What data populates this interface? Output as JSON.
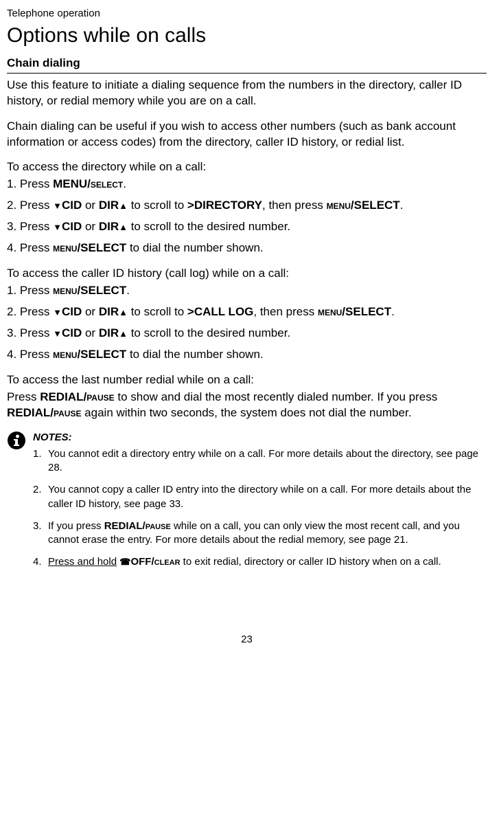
{
  "breadcrumb": "Telephone operation",
  "title": "Options while on calls",
  "section_heading": "Chain dialing",
  "intro1": "Use this feature to initiate a dialing sequence from the numbers in the directory, caller ID history, or redial memory while you are on a call.",
  "intro2": "Chain dialing can be useful if you wish to access other numbers (such as bank account information or access codes) from the directory, caller ID history, or redial list.",
  "dir_head": "To access the directory while on a call:",
  "dir_steps": {
    "s1a": "1. Press ",
    "s1b": "MENU/",
    "s1c": "SELECT",
    "s1d": ".",
    "s2a": "2. Press ",
    "s2b": "CID",
    "s2c": " or ",
    "s2d": "DIR",
    "s2e": " to scroll to ",
    "s2f": ">DIRECTORY",
    "s2g": ", then press ",
    "s2h": "MENU",
    "s2i": "/SELECT",
    "s2j": ".",
    "s3a": "3. Press ",
    "s3b": "CID",
    "s3c": " or ",
    "s3d": "DIR",
    "s3e": " to scroll to the desired number.",
    "s4a": "4. Press ",
    "s4b": "MENU",
    "s4c": "/SELECT",
    "s4d": " to dial the number shown."
  },
  "log_head": "To access the caller ID history (call log) while on a call:",
  "log_steps": {
    "s1a": "1. Press ",
    "s1b": "MENU",
    "s1c": "/SELECT",
    "s1d": ".",
    "s2a": "2. Press ",
    "s2b": "CID",
    "s2c": " or ",
    "s2d": "DIR",
    "s2e": " to scroll to ",
    "s2f": ">CALL LOG",
    "s2g": ", then press ",
    "s2h": "MENU",
    "s2i": "/SELECT",
    "s2j": ".",
    "s3a": "3. Press ",
    "s3b": "CID",
    "s3c": " or ",
    "s3d": "DIR",
    "s3e": " to scroll to the desired number.",
    "s4a": "4. Press ",
    "s4b": "MENU",
    "s4c": "/SELECT",
    "s4d": " to dial the number shown."
  },
  "redial_head": "To access the last number redial while on a call:",
  "redial": {
    "a": "Press ",
    "b": "REDIAL/",
    "c": "PAUSE",
    "d": " to show and dial the most recently dialed number. If you press ",
    "e": "REDIAL/",
    "f": "PAUSE",
    "g": " again within two seconds, the system does not dial the number."
  },
  "notes_label": "NOTES:",
  "notes": {
    "n1": "You cannot edit a directory entry while on a call. For more details about the directory, see page 28.",
    "n2": "You cannot copy a caller ID entry into the directory while on a call. For more details about the caller ID history, see page 33.",
    "n3a": "If you press ",
    "n3b": "REDIAL/",
    "n3c": "PAUSE",
    "n3d": " while on a call, you can only view the most recent call, and you cannot erase the entry. For more details about the redial memory, see page 21.",
    "n4a": "Press and hold",
    "n4b": " ",
    "n4c": "OFF/",
    "n4d": "CLEAR",
    "n4e": " to exit redial, directory or caller ID history when on a call."
  },
  "page": "23"
}
